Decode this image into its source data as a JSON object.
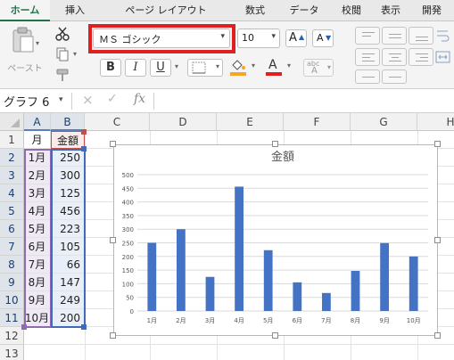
{
  "ribbon_tabs": [
    "ホーム",
    "挿入",
    "ページ レイアウト",
    "数式",
    "データ",
    "校閲",
    "表示",
    "開発"
  ],
  "ribbon": {
    "paste_label": "ペースト",
    "font_name": "ＭＳ ゴシック",
    "font_size": "10",
    "bold_label": "B",
    "italic_label": "I",
    "underline_label": "U",
    "grow_font_label": "A",
    "shrink_font_label": "A",
    "font_color_label": "A",
    "phonetic_label": "abc",
    "phonetic_sub": "A",
    "highlight_color": "#e02020",
    "font_color_bar": "#e02020",
    "fill_color_bar": "#f5a623"
  },
  "formula_bar": {
    "name_box": "グラフ 6",
    "cancel_icon": "×",
    "enter_icon": "✓",
    "fx_label": "fx",
    "formula": ""
  },
  "sheet": {
    "columns": [
      "A",
      "B",
      "C",
      "D",
      "E",
      "F",
      "G",
      "H"
    ],
    "rows": [
      "1",
      "2",
      "3",
      "4",
      "5",
      "6",
      "7",
      "8",
      "9",
      "10",
      "11",
      "12",
      "13"
    ],
    "header_a": "月",
    "header_b": "金額",
    "months": [
      "1月",
      "2月",
      "3月",
      "4月",
      "5月",
      "6月",
      "7月",
      "8月",
      "9月",
      "10月"
    ],
    "amounts": [
      "250",
      "300",
      "125",
      "456",
      "223",
      "105",
      "66",
      "147",
      "249",
      "200"
    ]
  },
  "chart_data": {
    "type": "bar",
    "title": "金額",
    "categories": [
      "1月",
      "2月",
      "3月",
      "4月",
      "5月",
      "6月",
      "7月",
      "8月",
      "9月",
      "10月"
    ],
    "values": [
      250,
      300,
      125,
      456,
      223,
      105,
      66,
      147,
      249,
      200
    ],
    "ylim": [
      0,
      500
    ],
    "yticks": [
      "0",
      "50",
      "100",
      "150",
      "200",
      "250",
      "300",
      "350",
      "400",
      "450",
      "500"
    ],
    "grid": true,
    "bar_color": "#4472c4"
  }
}
